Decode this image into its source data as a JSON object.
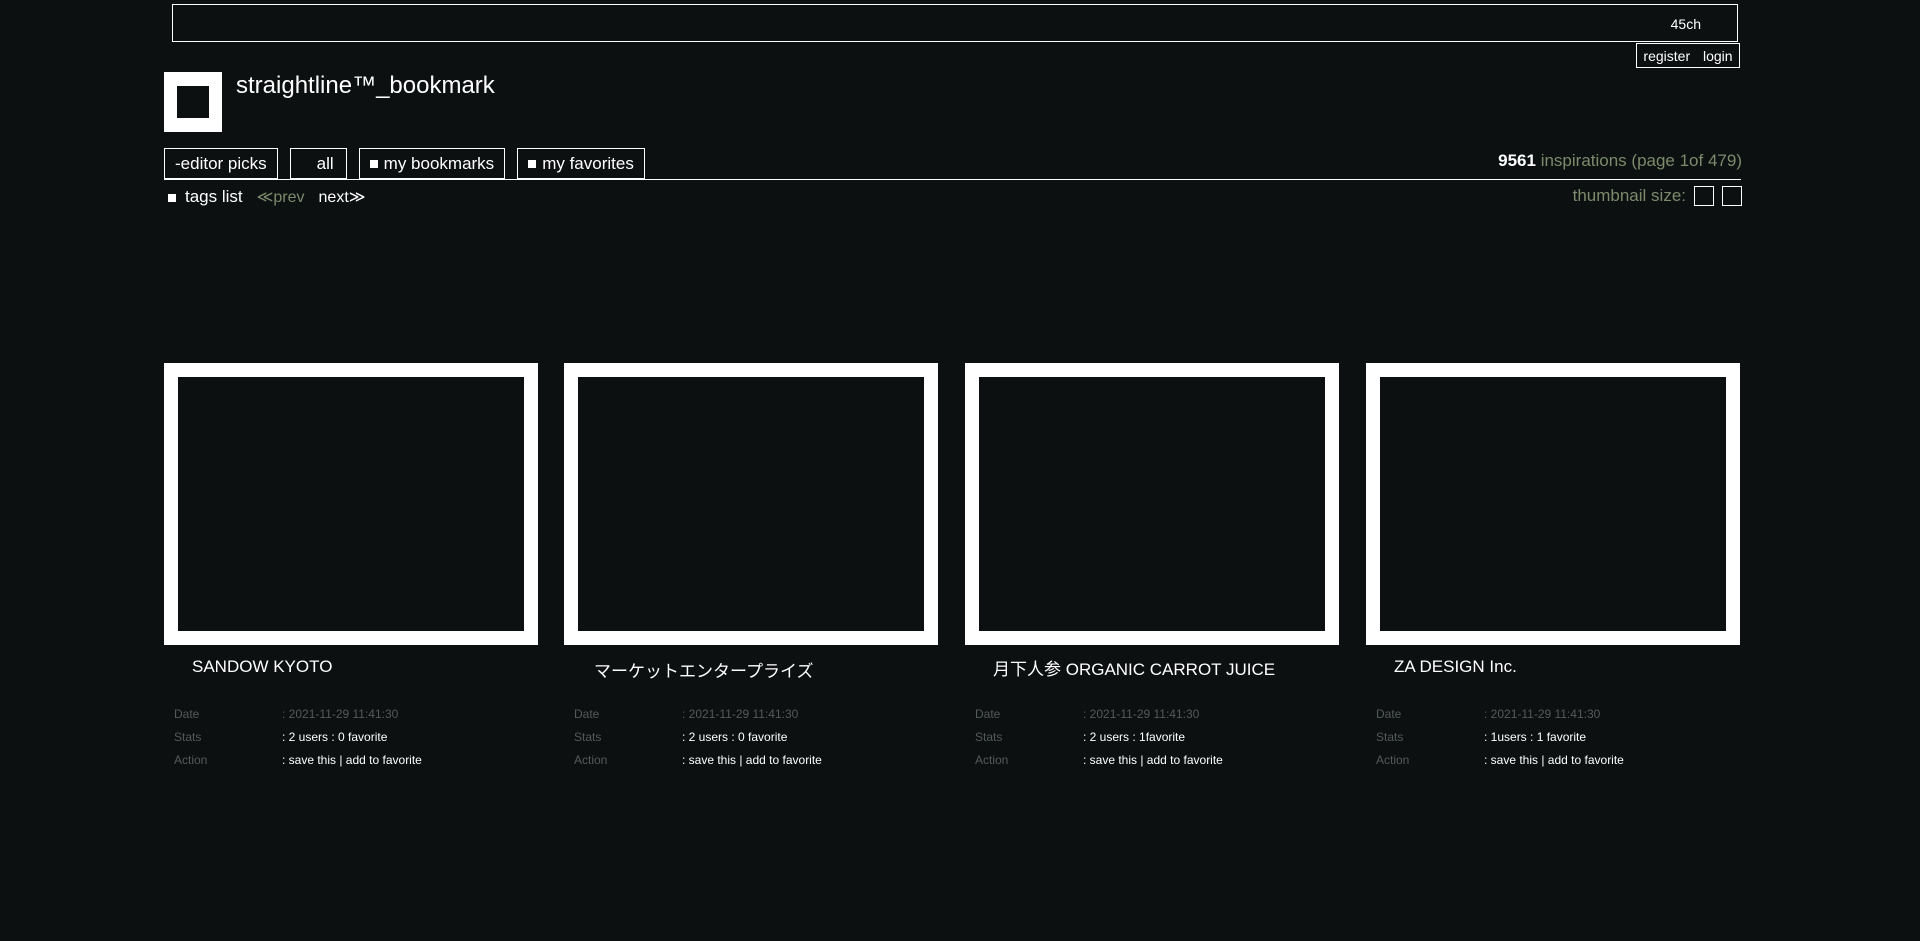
{
  "header": {
    "count": "45ch",
    "register": "register",
    "login": "login",
    "site_title": "straightline™_bookmark"
  },
  "tabs": [
    {
      "label": "-editor picks",
      "square": false
    },
    {
      "label": "all",
      "square": false
    },
    {
      "label": "my bookmarks",
      "square": true
    },
    {
      "label": "my favorites",
      "square": true
    }
  ],
  "summary": {
    "count": "9561",
    "text": " inspirations (page  1of  479)"
  },
  "subnav": {
    "tags": "tags list",
    "prev": "≪prev",
    "next": "next≫",
    "thumb_label": "thumbnail size:"
  },
  "cards": [
    {
      "title": "SANDOW KYOTO",
      "date_label": "Date",
      "date": ": 2021-11-29 11:41:30",
      "stats_label": "Stats",
      "stats": ": 2 users : 0 favorite",
      "action_label": "Action",
      "action": ": save this | add to favorite"
    },
    {
      "title": "マーケットエンタープライズ",
      "date_label": "Date",
      "date": ": 2021-11-29 11:41:30",
      "stats_label": "Stats",
      "stats": ": 2 users : 0 favorite",
      "action_label": "Action",
      "action": ": save this | add to favorite"
    },
    {
      "title": "月下人参 ORGANIC CARROT JUICE",
      "date_label": "Date",
      "date": ": 2021-11-29 11:41:30",
      "stats_label": "Stats",
      "stats": ": 2 users : 1favorite",
      "action_label": "Action",
      "action": ": save this | add to favorite"
    },
    {
      "title": "ZA DESIGN Inc.",
      "date_label": "Date",
      "date": ": 2021-11-29 11:41:30",
      "stats_label": "Stats",
      "stats": ": 1users : 1 favorite",
      "action_label": "Action",
      "action": ": save this | add to favorite"
    }
  ],
  "colors": {
    "background": "#0d1011",
    "accent_green": "#7b8a6b",
    "dim_text": "#545a58"
  }
}
